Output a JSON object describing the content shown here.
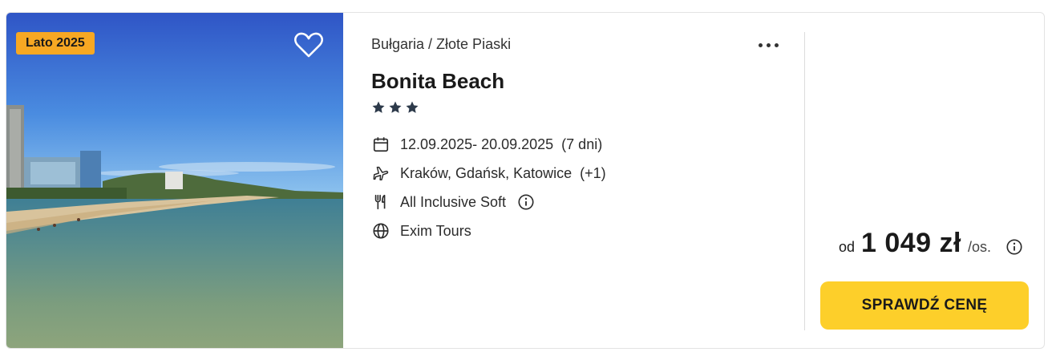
{
  "offer": {
    "badge": "Lato 2025",
    "favorite_icon": "heart-icon",
    "location": "Bułgaria / Złote Piaski",
    "more_icon": "more-dots-icon",
    "hotel_name": "Bonita Beach",
    "stars": 3,
    "dates": "12.09.2025- 20.09.2025",
    "duration": "(7 dni)",
    "departures": "Kraków, Gdańsk, Katowice",
    "departures_extra": "(+1)",
    "board": "All Inclusive Soft",
    "operator": "Exim Tours"
  },
  "price": {
    "prefix": "od",
    "amount": "1 049 zł",
    "suffix": "/os."
  },
  "cta": {
    "label": "SPRAWDŹ CENĘ"
  },
  "colors": {
    "badge": "#f7a823",
    "cta": "#fdcf2a",
    "star": "#2d3a4a"
  }
}
